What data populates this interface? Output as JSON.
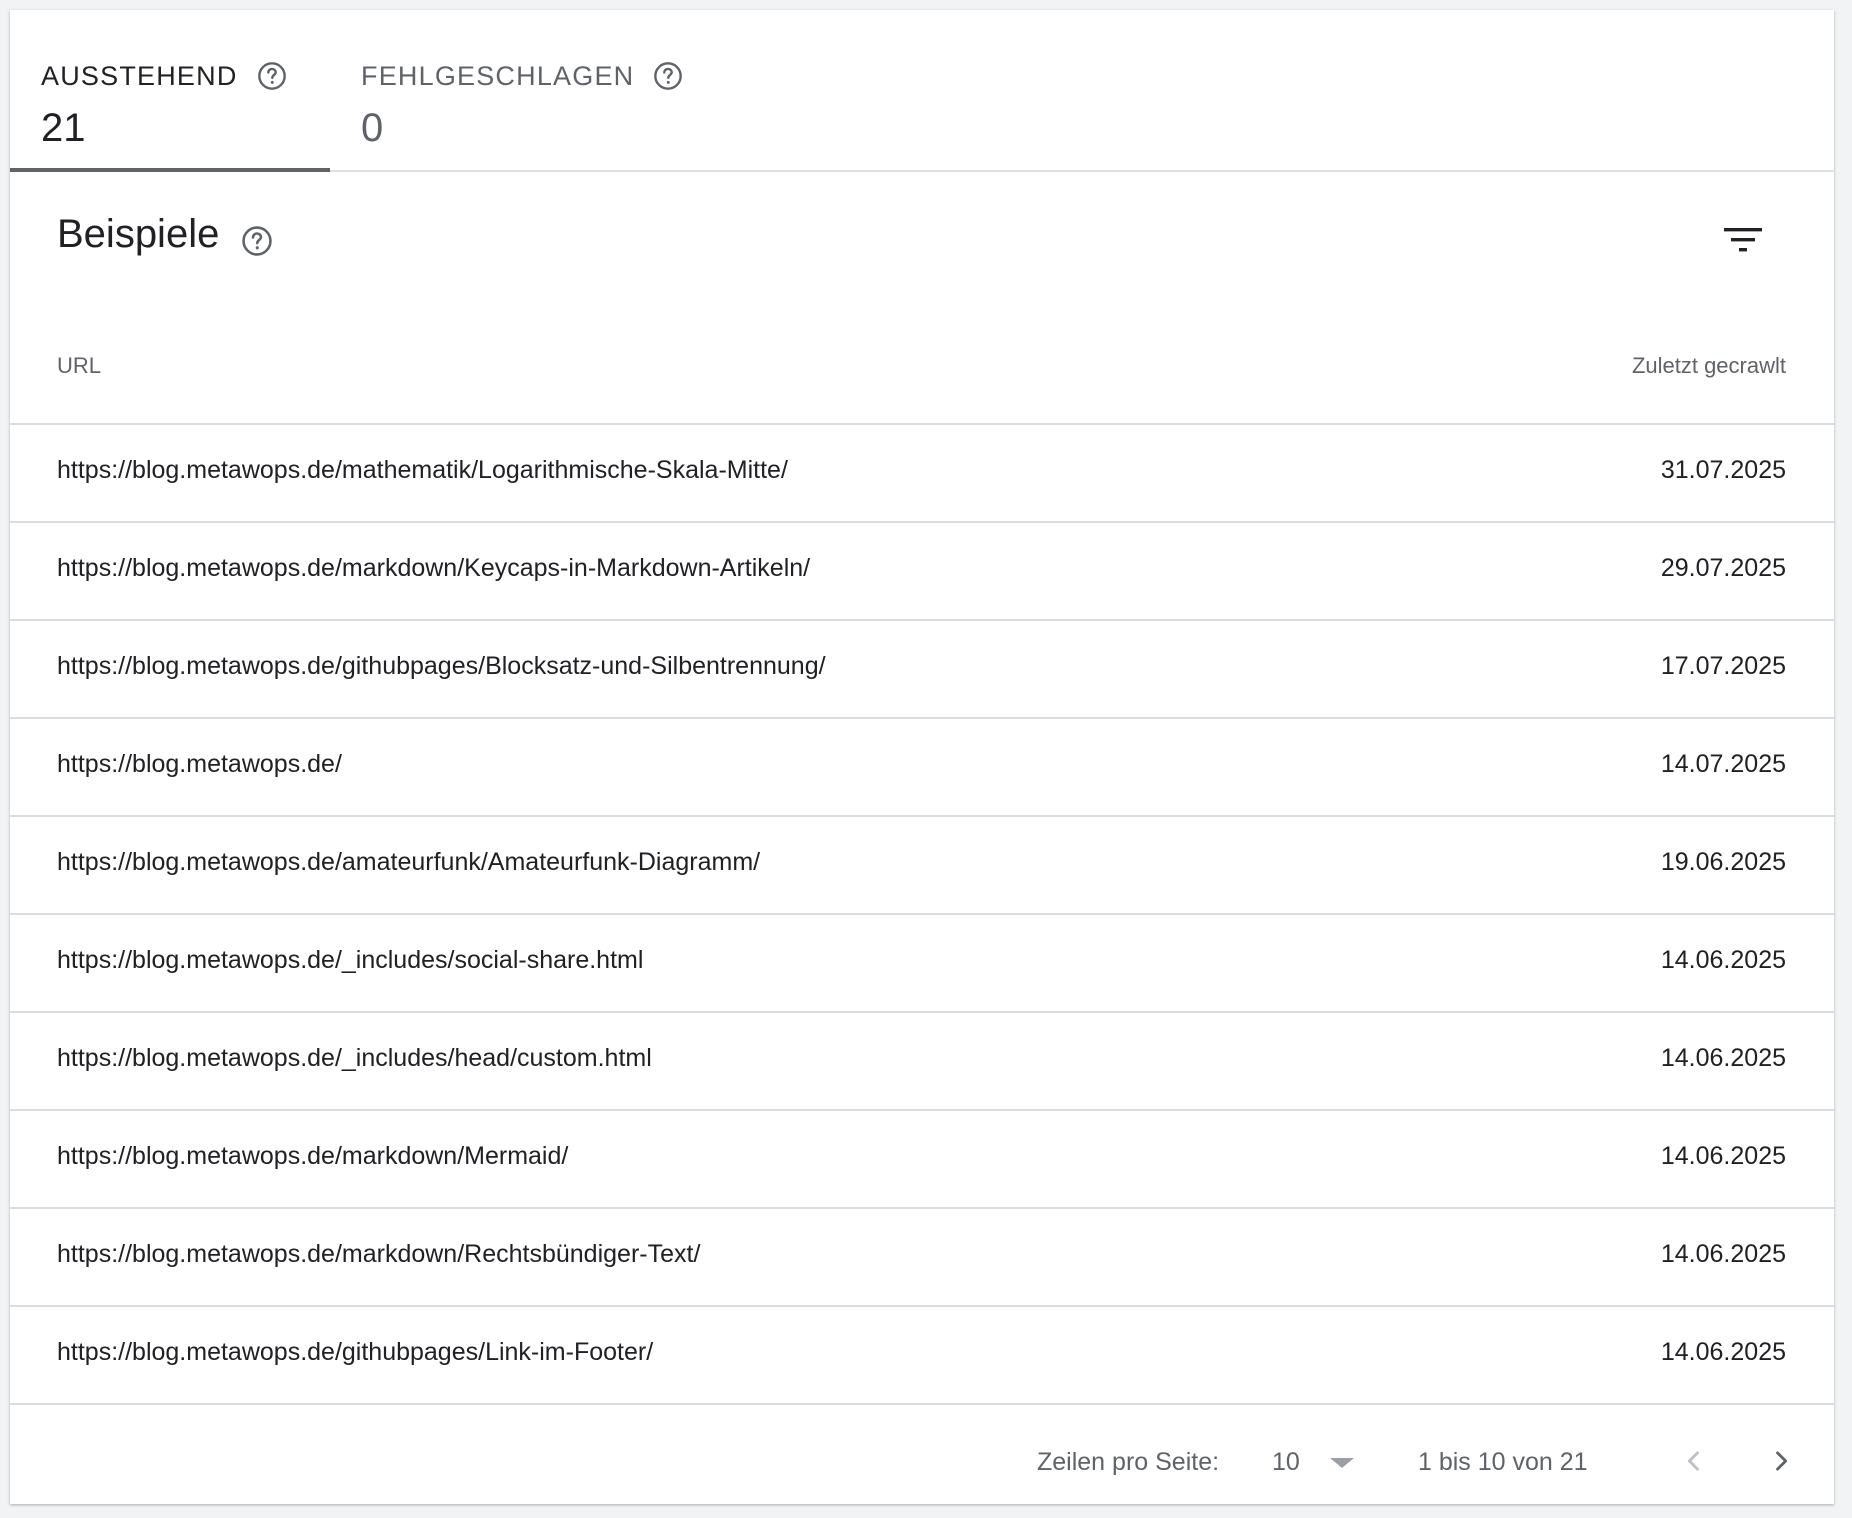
{
  "tabs": [
    {
      "label": "AUSSTEHEND",
      "count": "21",
      "help_icon": "help-circle-icon",
      "active": true
    },
    {
      "label": "FEHLGESCHLAGEN",
      "count": "0",
      "help_icon": "help-circle-icon",
      "active": false
    }
  ],
  "section": {
    "title": "Beispiele",
    "help_icon": "help-circle-icon",
    "filter_icon": "filter-icon"
  },
  "table": {
    "columns": [
      "URL",
      "Zuletzt gecrawlt"
    ],
    "rows": [
      {
        "url": "https://blog.metawops.de/mathematik/Logarithmische-Skala-Mitte/",
        "date": "31.07.2025"
      },
      {
        "url": "https://blog.metawops.de/markdown/Keycaps-in-Markdown-Artikeln/",
        "date": "29.07.2025"
      },
      {
        "url": "https://blog.metawops.de/githubpages/Blocksatz-und-Silbentrennung/",
        "date": "17.07.2025"
      },
      {
        "url": "https://blog.metawops.de/",
        "date": "14.07.2025"
      },
      {
        "url": "https://blog.metawops.de/amateurfunk/Amateurfunk-Diagramm/",
        "date": "19.06.2025"
      },
      {
        "url": "https://blog.metawops.de/_includes/social-share.html",
        "date": "14.06.2025"
      },
      {
        "url": "https://blog.metawops.de/_includes/head/custom.html",
        "date": "14.06.2025"
      },
      {
        "url": "https://blog.metawops.de/markdown/Mermaid/",
        "date": "14.06.2025"
      },
      {
        "url": "https://blog.metawops.de/markdown/Rechtsbündiger-Text/",
        "date": "14.06.2025"
      },
      {
        "url": "https://blog.metawops.de/githubpages/Link-im-Footer/",
        "date": "14.06.2025"
      }
    ]
  },
  "pagination": {
    "rows_per_page_label": "Zeilen pro Seite:",
    "rows_per_page_value": "10",
    "range": "1 bis 10 von 21",
    "prev_icon": "chevron-left-icon",
    "next_icon": "chevron-right-icon"
  },
  "colors": {
    "text": "#202124",
    "muted": "#5f6368",
    "divider": "#dadce0",
    "disabled": "#bdc1c6"
  }
}
